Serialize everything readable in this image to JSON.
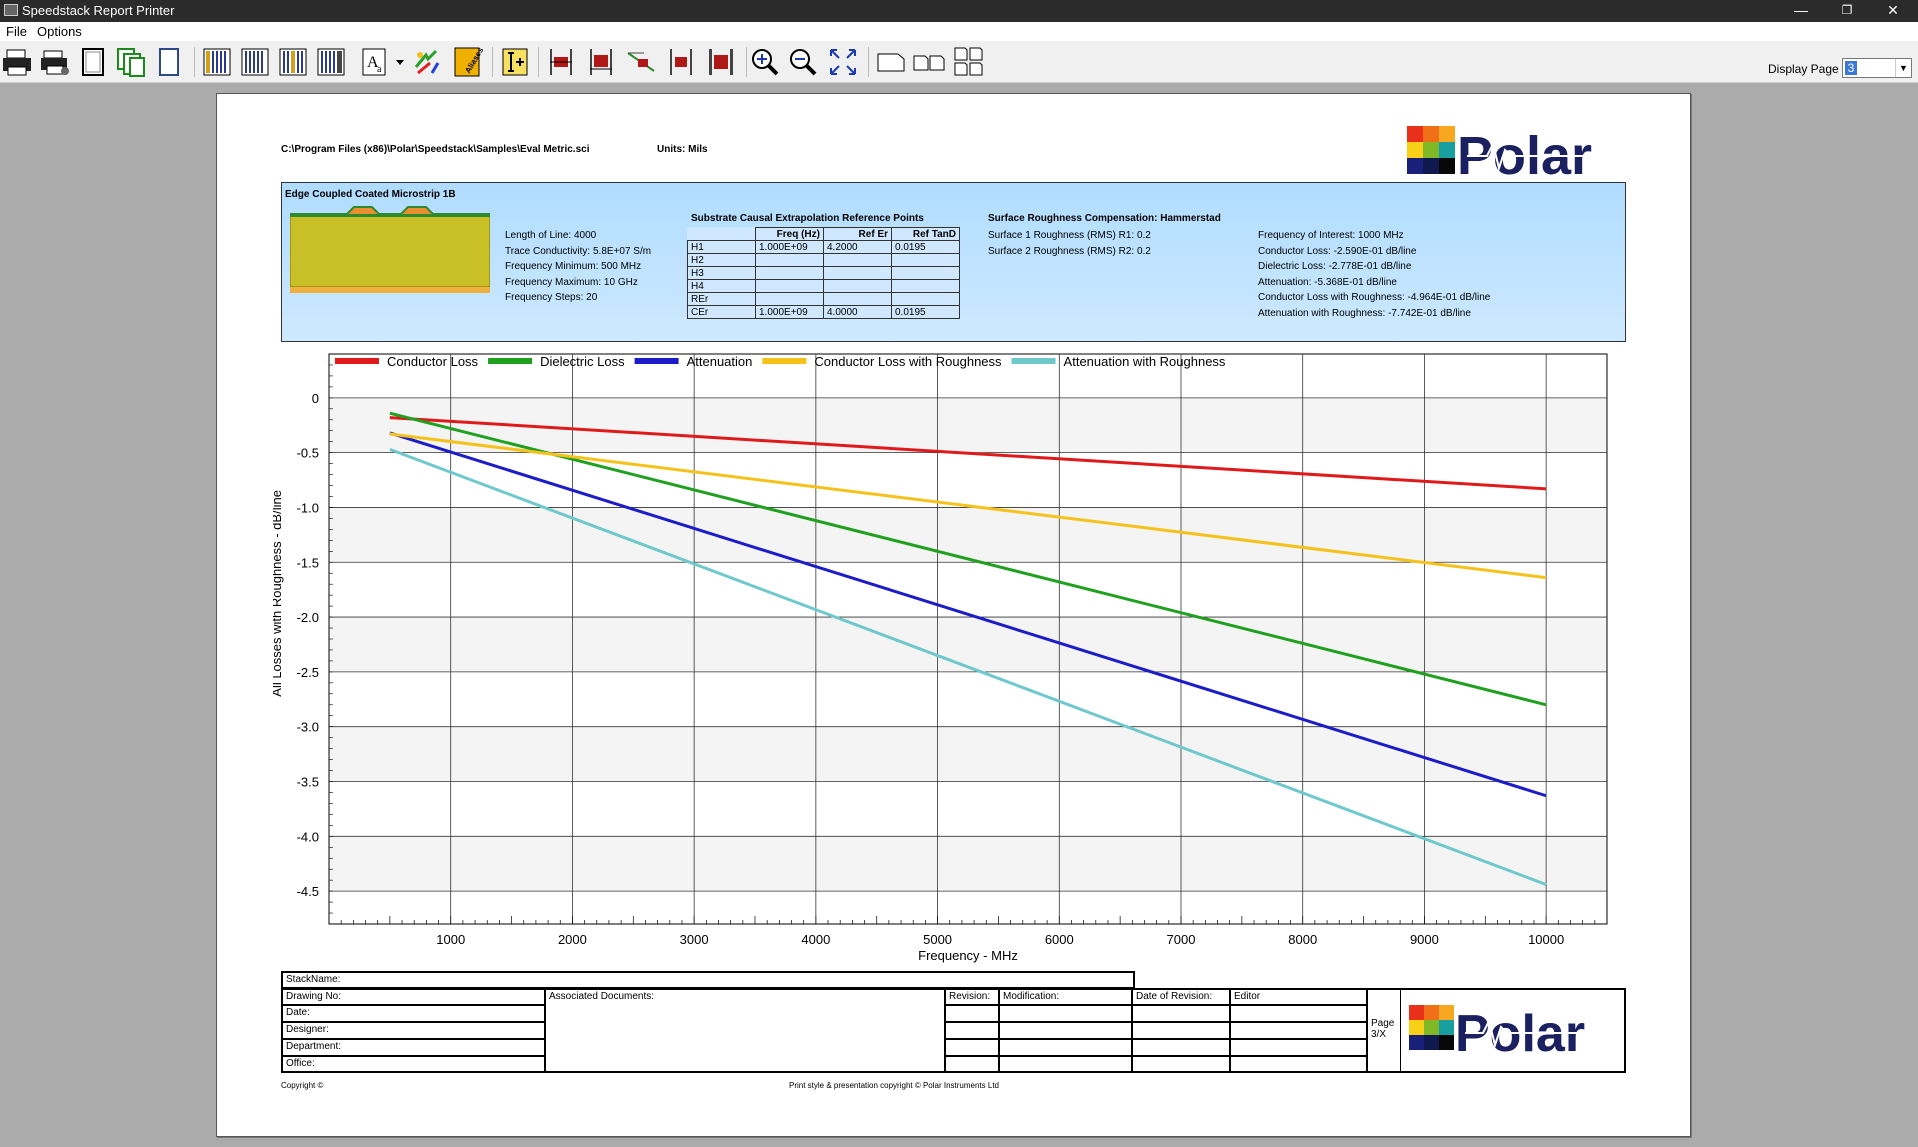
{
  "window": {
    "title": "Speedstack Report Printer",
    "minimize": "—",
    "restore": "❐",
    "close": "✕"
  },
  "menu": {
    "file": "File",
    "options": "Options"
  },
  "toolbar": {
    "display_page_label": "Display Page",
    "display_page_value": "3",
    "buttons": [
      "print-icon",
      "print-setup-icon",
      "page-portrait-icon",
      "multi-page-icon",
      "blank-page-icon",
      "columns-1-icon",
      "columns-2-icon",
      "columns-3-icon",
      "columns-4-icon",
      "font-icon",
      "dropdown-arrow-icon",
      "color-refresh-icon",
      "aliases-icon",
      "insert-field-icon",
      "layer-1-icon",
      "layer-2-icon",
      "layer-3-icon",
      "layer-4-icon",
      "layer-5-icon",
      "zoom-in-icon",
      "zoom-out-icon",
      "fit-page-icon",
      "single-page-view-icon",
      "two-page-view-icon",
      "four-page-view-icon"
    ]
  },
  "report": {
    "file_path": "C:\\Program Files (x86)\\Polar\\Speedstack\\Samples\\Eval Metric.sci",
    "units": "Units: Mils",
    "structure_title": "Edge Coupled Coated Microstrip 1B",
    "params": [
      "Length of Line: 4000",
      "Trace Conductivity: 5.8E+07 S/m",
      "Frequency Minimum: 500 MHz",
      "Frequency Maximum: 10 GHz",
      "Frequency Steps: 20"
    ],
    "substrate": {
      "title": "Substrate Causal Extrapolation Reference Points",
      "headers": [
        "Freq (Hz)",
        "Ref Er",
        "Ref TanD"
      ],
      "rows": [
        [
          "H1",
          "1.000E+09",
          "4.2000",
          "0.0195"
        ],
        [
          "H2",
          "",
          "",
          ""
        ],
        [
          "H3",
          "",
          "",
          ""
        ],
        [
          "H4",
          "",
          "",
          ""
        ],
        [
          "REr",
          "",
          "",
          ""
        ],
        [
          "CEr",
          "1.000E+09",
          "4.0000",
          "0.0195"
        ]
      ]
    },
    "roughness": {
      "title": "Surface Roughness Compensation: Hammerstad",
      "lines": [
        "Surface 1 Roughness (RMS) R1: 0.2",
        "Surface 2 Roughness (RMS) R2: 0.2"
      ]
    },
    "results": [
      "Frequency of Interest: 1000 MHz",
      "Conductor Loss: -2.590E-01 dB/line",
      "Dielectric Loss: -2.778E-01 dB/line",
      "Attenuation: -5.368E-01 dB/line",
      "Conductor Loss with Roughness: -4.964E-01 dB/line",
      "Attenuation with Roughness: -7.742E-01 dB/line"
    ],
    "logo_text": "Polar",
    "title_block": {
      "stack_name": "StackName:",
      "left_labels": [
        "Drawing No:",
        "Date:",
        "Designer:",
        "Department:",
        "Office:"
      ],
      "associated_docs": "Associated Documents:",
      "revision": "Revision:",
      "modification": "Modification:",
      "date_of_revision": "Date of Revision:",
      "editor": "Editor",
      "page_label": "Page",
      "page_value": "3/X"
    },
    "copyright_left": "Copyright ©",
    "copyright_center": "Print style & presentation copyright © Polar Instruments Ltd"
  },
  "chart_data": {
    "type": "line",
    "xlabel": "Frequency - MHz",
    "ylabel": "All Losses with Roughness - dB/line",
    "xlim": [
      0,
      10500
    ],
    "ylim": [
      -4.8,
      0.4
    ],
    "xticks": [
      1000,
      2000,
      3000,
      4000,
      5000,
      6000,
      7000,
      8000,
      9000,
      10000
    ],
    "yticks": [
      0,
      -0.5,
      -1.0,
      -1.5,
      -2.0,
      -2.5,
      -3.0,
      -3.5,
      -4.0,
      -4.5
    ],
    "ytick_labels": [
      "0",
      "-0.5",
      "-1.0",
      "-1.5",
      "-2.0",
      "-2.5",
      "-3.0",
      "-3.5",
      "-4.0",
      "-4.5"
    ],
    "legend_position": "top",
    "grid": true,
    "x": [
      500,
      10000
    ],
    "series": [
      {
        "name": "Conductor Loss",
        "color": "#e01a1a",
        "values": [
          -0.18,
          -0.83
        ]
      },
      {
        "name": "Dielectric Loss",
        "color": "#1fa01f",
        "values": [
          -0.14,
          -2.8
        ]
      },
      {
        "name": "Attenuation",
        "color": "#1c1cc8",
        "values": [
          -0.32,
          -3.63
        ]
      },
      {
        "name": "Conductor Loss with Roughness",
        "color": "#f5c21b",
        "values": [
          -0.33,
          -1.64
        ]
      },
      {
        "name": "Attenuation with Roughness",
        "color": "#6fc9cc",
        "values": [
          -0.47,
          -4.44
        ]
      }
    ]
  }
}
